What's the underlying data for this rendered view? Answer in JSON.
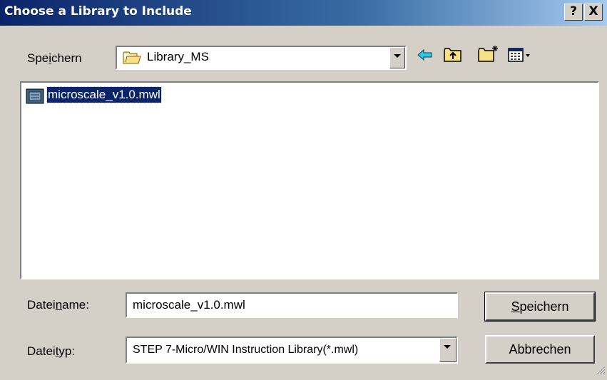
{
  "window": {
    "title": "Choose a Library to Include",
    "help_label": "?",
    "close_label": "X"
  },
  "location": {
    "label_pre": "Spe",
    "label_access": "i",
    "label_post": "chern",
    "value": "Library_MS"
  },
  "file_list": {
    "items": [
      {
        "name": "microscale_v1.0.mwl",
        "selected": true
      }
    ]
  },
  "filename": {
    "label_pre": "Datei",
    "label_access": "n",
    "label_post": "ame:",
    "value": "microscale_v1.0.mwl"
  },
  "filetype": {
    "label_pre": "Datei",
    "label_access": "t",
    "label_post": "yp:",
    "value": "STEP 7-Micro/WIN Instruction Library(*.mwl)"
  },
  "buttons": {
    "save_access": "S",
    "save_rest": "peichern",
    "cancel_label": "Abbrechen"
  },
  "colors": {
    "selection": "#0a246a",
    "title_start": "#0a246a",
    "title_end": "#a6caf0",
    "face": "#d4d0c8"
  }
}
